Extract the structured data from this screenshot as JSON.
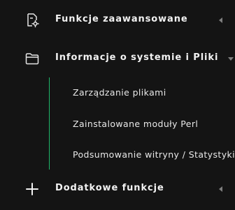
{
  "menu": {
    "sections": [
      {
        "label": "Funkcje zaawansowane",
        "icon": "advanced-settings-icon",
        "state": "collapsed"
      },
      {
        "label": "Informacje o systemie i Pliki",
        "icon": "folder-icon",
        "state": "expanded"
      },
      {
        "label": "Dodatkowe funkcje",
        "icon": "plus-icon",
        "state": "collapsed"
      }
    ],
    "submenu": [
      "Zarządzanie plikami",
      "Zainstalowane moduły Perl",
      "Podsumowanie witryny / Statystyki /"
    ]
  },
  "colors": {
    "background": "#141414",
    "text": "#f2f2f2",
    "accent_line": "#1fb86a",
    "caret": "#7f7f7f"
  }
}
